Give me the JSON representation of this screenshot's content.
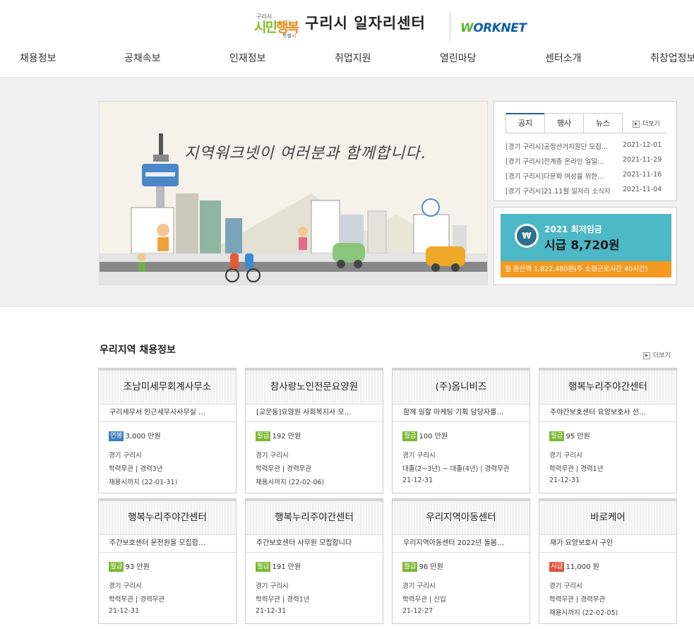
{
  "header": {
    "city_logo": {
      "small": "구리시",
      "main_a": "시민",
      "main_b": "행복",
      "sub": "특별시"
    },
    "site_title": "구리시 일자리센터",
    "worknet_logo": {
      "w": "W",
      "rest": "ORKNET"
    }
  },
  "nav": [
    "채용정보",
    "공채속보",
    "인재정보",
    "취업지원",
    "열린마당",
    "센터소개",
    "취창업정보"
  ],
  "banner": {
    "slogan": "지역워크넷이 여러분과 함께합니다."
  },
  "notice": {
    "tabs": [
      "공지",
      "행사",
      "뉴스"
    ],
    "active_tab": "공지",
    "more": "더보기",
    "items": [
      {
        "title": "[경기 구리시]공정선거지원단 모집…",
        "date": "2021-12-01"
      },
      {
        "title": "[경기 구리시]전계층 온라인 일일…",
        "date": "2021-11-29"
      },
      {
        "title": "[경기 구리시]다문화 여성을 위한…",
        "date": "2021-11-16"
      },
      {
        "title": "[경기 구리시]21.11월 일자리 소식지",
        "date": "2021-11-04"
      }
    ]
  },
  "wage": {
    "coin": "₩",
    "title": "2021 최저임금",
    "amount": "시급 8,720원",
    "bar": "월 환산액 1,822,480원(주 소정근로시간 40시간)",
    "colors": {
      "bg": "#4db8c6",
      "bar": "#f39a22"
    }
  },
  "jobs": {
    "title": "우리지역 채용정보",
    "more": "더보기",
    "badge_colors": {
      "연봉": "#3a7fc1",
      "월급": "#7cb832",
      "시급": "#e0533a"
    },
    "cards": [
      {
        "company": "조남미세무회계사무소",
        "desc": "구리세무서 인근세무사사무실 …",
        "pay_type": "연봉",
        "pay": "3,000 만원",
        "region": "경기 구리시",
        "req": "학력무관 | 경력3년",
        "deadline": "채용시까지 (22-01-31)"
      },
      {
        "company": "참사랑노인전문요양원",
        "desc": "[교문동]요양원 사회복지사 모…",
        "pay_type": "월급",
        "pay": "192 만원",
        "region": "경기 구리시",
        "req": "학력무관 | 경력무관",
        "deadline": "채용시까지 (22-02-06)"
      },
      {
        "company": "(주)옴니비즈",
        "desc": "함께 일할 마케팅 기획 담당자를…",
        "pay_type": "월급",
        "pay": "100 만원",
        "region": "경기 구리시",
        "req": "대졸(2~3년) ~ 대졸(4년) | 경력무관",
        "deadline": "21-12-31"
      },
      {
        "company": "행복누리주야간센터",
        "desc": "주야간보호센터 요양보호사 선…",
        "pay_type": "월급",
        "pay": "95 만원",
        "region": "경기 구리시",
        "req": "학력무관 | 경력1년",
        "deadline": "21-12-31"
      },
      {
        "company": "행복누리주야간센터",
        "desc": "주간보호센터 운전원을 모집합…",
        "pay_type": "월급",
        "pay": "93 만원",
        "region": "경기 구리시",
        "req": "학력무관 | 경력무관",
        "deadline": "21-12-31"
      },
      {
        "company": "행복누리주야간센터",
        "desc": "주간보호센터 사무원 모집합니다",
        "pay_type": "월급",
        "pay": "191 만원",
        "region": "경기 구리시",
        "req": "학력무관 | 경력1년",
        "deadline": "21-12-31"
      },
      {
        "company": "우리지역아동센터",
        "desc": "우리지역아동센터 2022년 돌봄…",
        "pay_type": "월급",
        "pay": "96 만원",
        "region": "경기 구리시",
        "req": "학력무관 | 신입",
        "deadline": "21-12-27"
      },
      {
        "company": "바로케어",
        "desc": "재가 요양보호사 구인",
        "pay_type": "시급",
        "pay": "11,000 원",
        "region": "경기 구리시",
        "req": "학력무관 | 경력무관",
        "deadline": "채용시까지 (22-02-05)"
      }
    ]
  }
}
